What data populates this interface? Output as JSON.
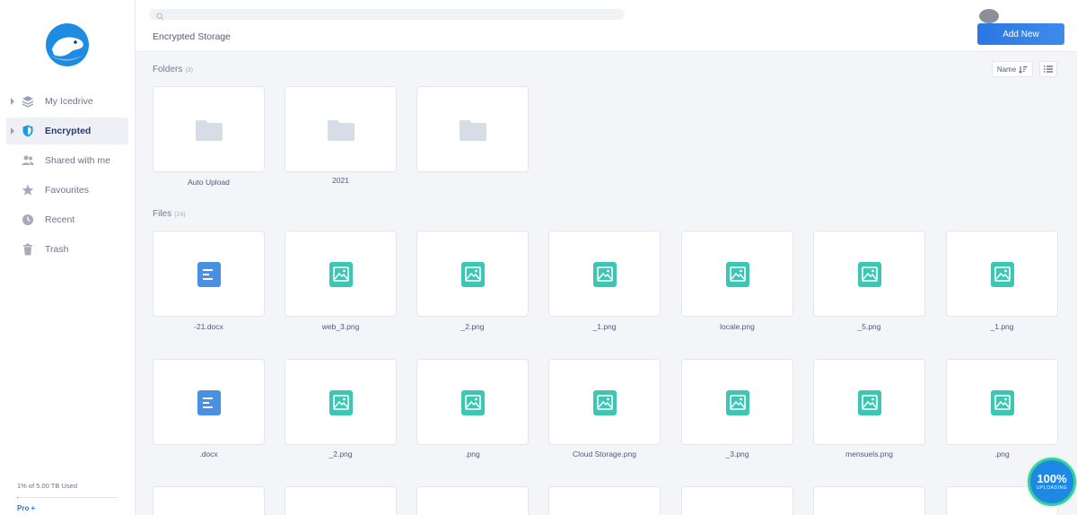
{
  "sidebar": {
    "items": [
      {
        "label": "My Icedrive",
        "icon": "layers-icon"
      },
      {
        "label": "Encrypted",
        "icon": "shield-icon"
      },
      {
        "label": "Shared with me",
        "icon": "users-icon"
      },
      {
        "label": "Favourites",
        "icon": "star-icon"
      },
      {
        "label": "Recent",
        "icon": "clock-icon"
      },
      {
        "label": "Trash",
        "icon": "trash-icon"
      }
    ],
    "storage_text": "1% of 5.00 TB Used",
    "storage_fraction": 0.01,
    "pro_label": "Pro +"
  },
  "header": {
    "title": "Encrypted Storage",
    "add_label": "Add New"
  },
  "toolbar": {
    "sort_label": "Name"
  },
  "folders": {
    "label": "Folders",
    "count": "(3)",
    "items": [
      {
        "line1": "Auto Upload",
        "line2": ""
      },
      {
        "line1": "",
        "line2": "2021"
      },
      {
        "line1": "",
        "line2": ""
      }
    ]
  },
  "files": {
    "label": "Files",
    "count": "(24)",
    "row1": [
      {
        "type": "doc",
        "line1": "",
        "line2": "-21.docx"
      },
      {
        "type": "image",
        "line1": "",
        "line2": "web_3.png"
      },
      {
        "type": "image",
        "line1": "_2.png",
        "line2": ""
      },
      {
        "type": "image",
        "line1": "_1.png",
        "line2": ""
      },
      {
        "type": "image",
        "line1": "locale.png",
        "line2": ""
      },
      {
        "type": "image",
        "line1": "_5.png",
        "line2": ""
      },
      {
        "type": "image",
        "line1": "_1.png",
        "line2": ""
      }
    ],
    "row2": [
      {
        "type": "doc",
        "line1": ".docx",
        "line2": ""
      },
      {
        "type": "image",
        "line1": "",
        "line2": "_2.png"
      },
      {
        "type": "image",
        "line1": ".png",
        "line2": ""
      },
      {
        "type": "image",
        "line1": "",
        "line2": "Cloud Storage.png"
      },
      {
        "type": "image",
        "line1": "_3.png",
        "line2": ""
      },
      {
        "type": "image",
        "line1": "",
        "line2": "mensuels.png"
      },
      {
        "type": "image",
        "line1": ".png",
        "line2": ""
      }
    ]
  },
  "upload": {
    "percent": "100%",
    "label": "UPLOADING"
  },
  "colors": {
    "accent": "#2a77e4",
    "image_icon": "#3cc7b5",
    "doc_icon": "#4a90e2",
    "folder_icon": "#d7dde6"
  }
}
